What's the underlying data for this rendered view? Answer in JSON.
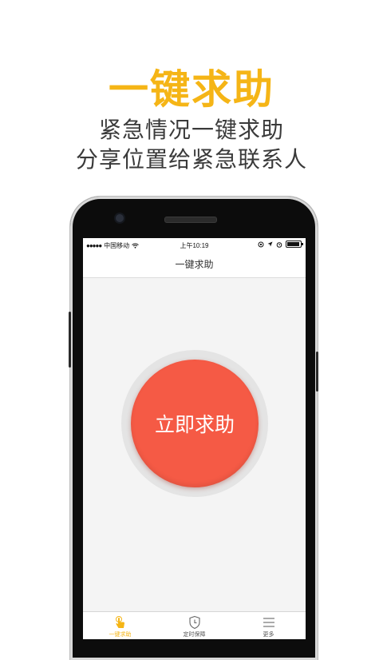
{
  "headline": "一键求助",
  "subtitle_line1": "紧急情况一键求助",
  "subtitle_line2": "分享位置给紧急联系人",
  "status_bar": {
    "carrier": "中国移动",
    "time": "上午10:19"
  },
  "nav_title": "一键求助",
  "help_button_label": "立即求助",
  "tabs": [
    {
      "label": "一键求助",
      "icon": "hand-tap-icon",
      "active": true
    },
    {
      "label": "定时保障",
      "icon": "shield-clock-icon",
      "active": false
    },
    {
      "label": "更多",
      "icon": "menu-icon",
      "active": false
    }
  ],
  "colors": {
    "accent": "#F5B516",
    "help_button": "#F55A45"
  }
}
